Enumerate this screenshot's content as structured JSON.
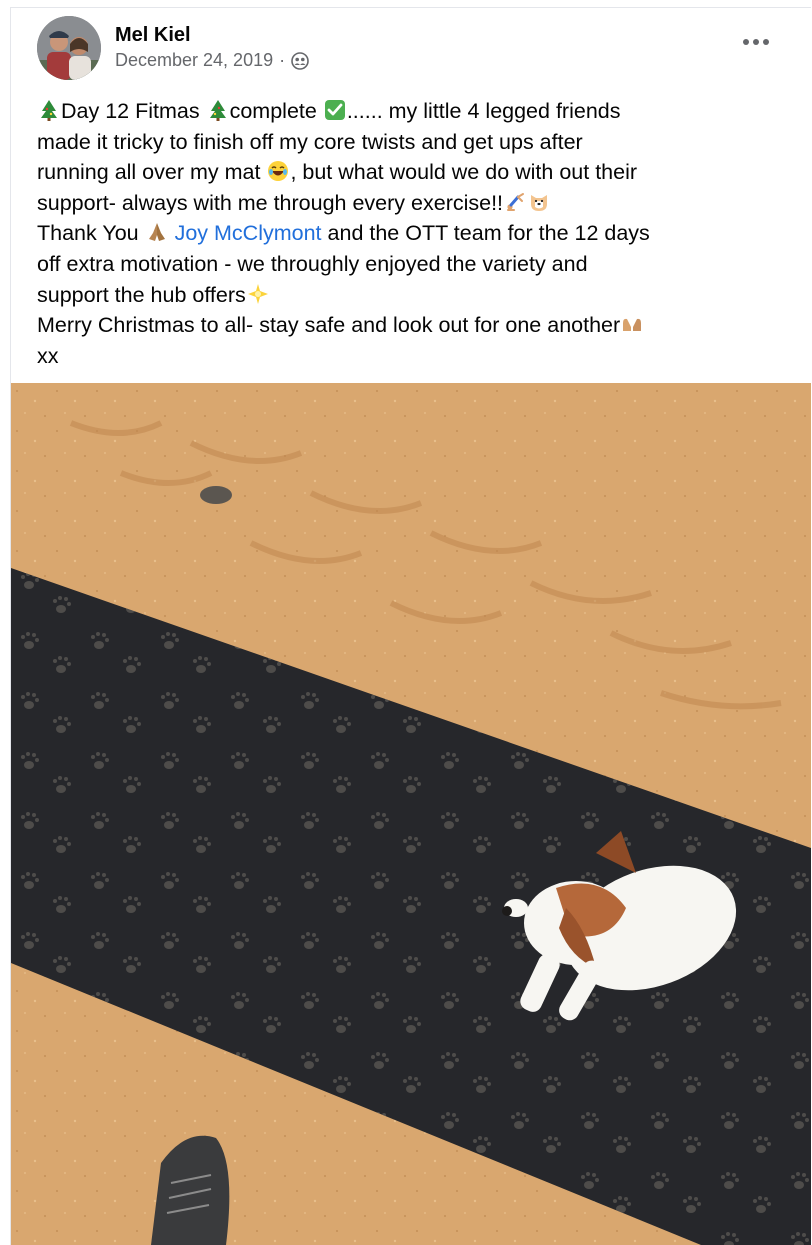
{
  "post": {
    "author": "Mel Kiel",
    "date": "December 24, 2019",
    "separator": "·",
    "audience_icon": "friends-icon",
    "more_icon": "more-options-icon",
    "text": {
      "l1_a": "Day 12 Fitmas",
      "l1_b": "complete",
      "l1_c": "...... my little 4 legged friends",
      "l2": "made it tricky to finish off my core twists and get ups after",
      "l3_a": "running all over my mat",
      "l3_b": ", but what would we do with out their",
      "l4_a": "support- always with me through every exercise!!",
      "l5_a": "Thank You",
      "l5_mention": "Joy McClymont",
      "l5_b": "and the OTT team for the 12 days",
      "l6": "off extra motivation - we throughly enjoyed the variety and",
      "l7_a": "support the hub offers",
      "l8_a": "Merry Christmas to all- stay safe and look out for one another",
      "l9": "xx"
    },
    "emojis": [
      "christmas-tree-icon",
      "check-mark-icon",
      "laughing-face-icon",
      "gymnast-icon",
      "dog-face-icon",
      "praying-hands-icon",
      "sparkle-star-icon",
      "raised-hands-icon"
    ]
  },
  "colors": {
    "mention": "#216fdb",
    "meta_text": "#65676b",
    "sand": "#d9a76f",
    "mat": "#26272b"
  }
}
